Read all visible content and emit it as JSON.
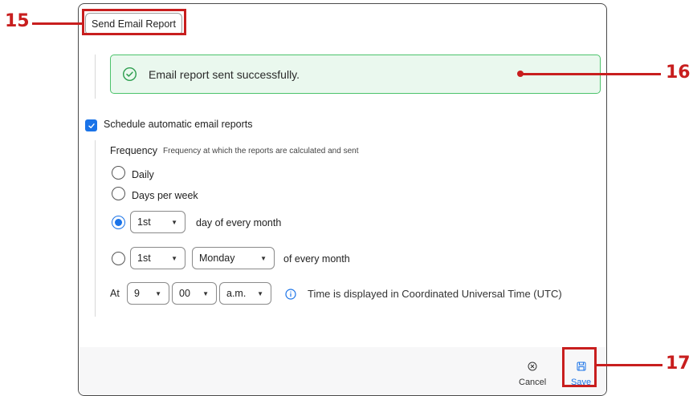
{
  "toolbar": {
    "send_label": "Send Email Report"
  },
  "success": {
    "message": "Email report sent successfully.",
    "icon": "check-circle-icon",
    "color": "#4cc36b"
  },
  "schedule": {
    "checkbox_label": "Schedule automatic email reports",
    "checked": true,
    "frequency_label": "Frequency",
    "frequency_help": "Frequency at which the reports are calculated and sent",
    "options": {
      "daily": "Daily",
      "days_per_week": "Days per week",
      "monthly_day_suffix": "day of every month",
      "monthly_weekday_suffix": "of every month"
    },
    "selected_option": "monthly_day",
    "monthly_day_value": "1st",
    "weekday_ordinal_value": "1st",
    "weekday_value": "Monday",
    "at_label": "At",
    "hour_value": "9",
    "minute_value": "00",
    "ampm_value": "a.m.",
    "tz_note": "Time is displayed in Coordinated Universal Time (UTC)"
  },
  "footer": {
    "cancel_label": "Cancel",
    "save_label": "Save"
  },
  "annotations": {
    "a15": "15",
    "a16": "16",
    "a17": "17"
  },
  "colors": {
    "accent": "#1a73e8",
    "annotation": "#c81e1e"
  }
}
